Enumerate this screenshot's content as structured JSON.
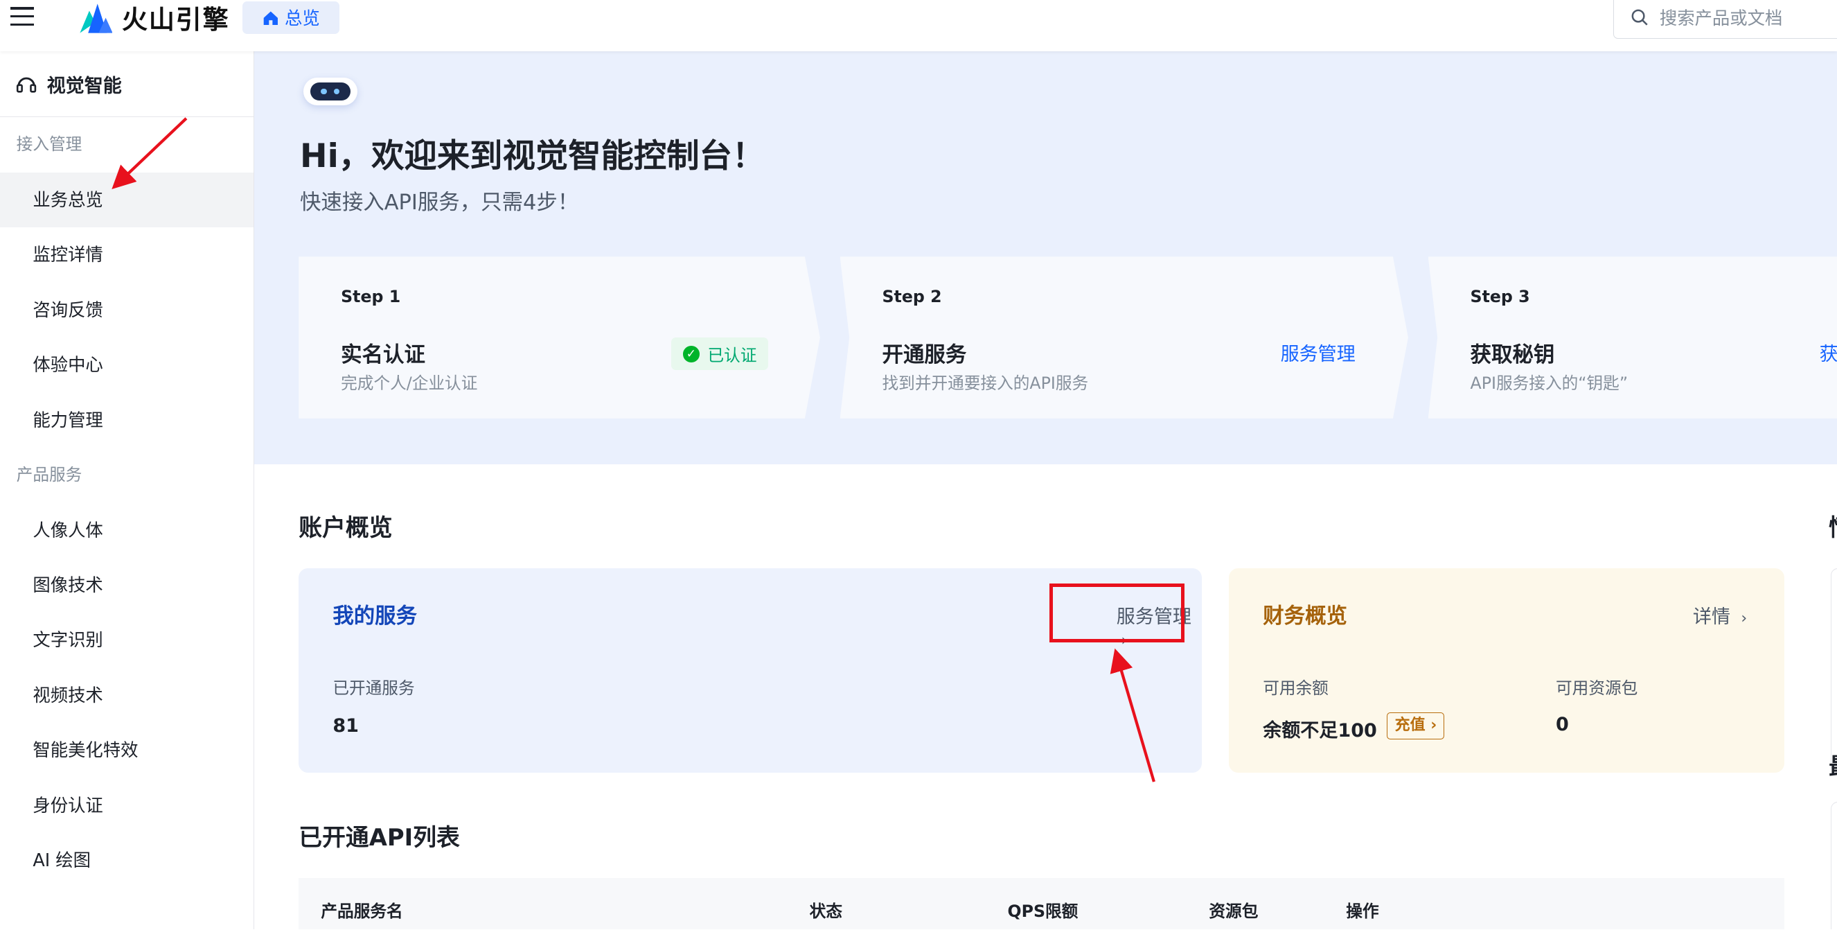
{
  "header": {
    "brand": "火山引擎",
    "home_tab": "总览",
    "search_placeholder": "搜索产品或文档"
  },
  "sidebar": {
    "title": "视觉智能",
    "groups": [
      {
        "label": "接入管理",
        "items": [
          "业务总览",
          "监控详情",
          "咨询反馈",
          "体验中心",
          "能力管理"
        ]
      },
      {
        "label": "产品服务",
        "items": [
          "人像人体",
          "图像技术",
          "文字识别",
          "视频技术",
          "智能美化特效",
          "身份认证",
          "AI 绘图"
        ]
      }
    ],
    "active_item": "业务总览"
  },
  "hero": {
    "title": "Hi，欢迎来到视觉智能控制台！",
    "subtitle": "快速接入API服务，只需4步！"
  },
  "steps": [
    {
      "label": "Step 1",
      "title": "实名认证",
      "desc": "完成个人/企业认证",
      "badge": "已认证"
    },
    {
      "label": "Step 2",
      "title": "开通服务",
      "desc": "找到并开通要接入的API服务",
      "link": "服务管理"
    },
    {
      "label": "Step 3",
      "title": "获取秘钥",
      "desc": "API服务接入的“钥匙”",
      "link": "获"
    }
  ],
  "account": {
    "section_title": "账户概览",
    "my_services": {
      "title": "我的服务",
      "link": "服务管理",
      "label": "已开通服务",
      "value": "81"
    },
    "finance": {
      "title": "财务概览",
      "link": "详情",
      "balance_label": "可用余额",
      "balance_value": "余额不足100",
      "recharge": "充值",
      "package_label": "可用资源包",
      "package_value": "0"
    }
  },
  "api_list": {
    "section_title": "已开通API列表",
    "columns": [
      "产品服务名",
      "状态",
      "QPS限额",
      "资源包",
      "操作"
    ]
  },
  "right_peek": {
    "char1": "情",
    "char2": "最"
  },
  "colors": {
    "accent": "#1664ff",
    "annotation": "#e8111d",
    "hero_bg": "#eaf0fd"
  }
}
